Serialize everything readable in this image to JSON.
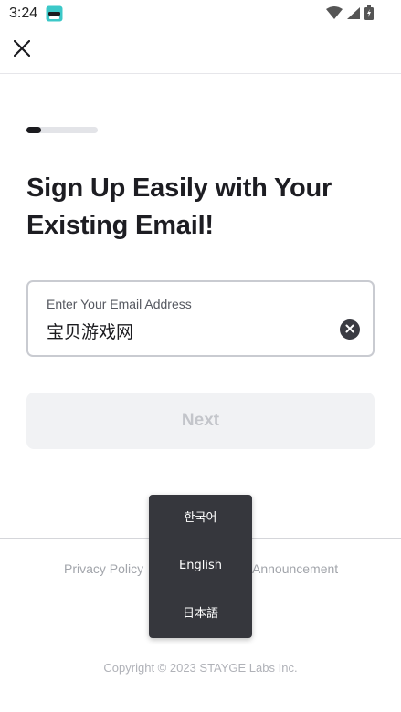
{
  "status_bar": {
    "time": "3:24"
  },
  "signup": {
    "title": "Sign Up Easily with Your Existing Email!",
    "progress": 0.2,
    "email": {
      "label": "Enter Your Email Address",
      "value": "宝贝游戏网"
    },
    "next_label": "Next"
  },
  "footer": {
    "privacy_policy": "Privacy Policy",
    "announcement": "Announcement",
    "copyright": "Copyright © 2023 STAYGE Labs Inc."
  },
  "language_menu": {
    "items": [
      "한국어",
      "English",
      "日本語"
    ]
  },
  "colors": {
    "accent_dark": "#1b1b1f",
    "disabled_bg": "#f1f2f4",
    "disabled_text": "#c3c5ca",
    "menu_bg": "#36373d"
  },
  "icons": {
    "close": "close-icon",
    "clear": "clear-circle-icon",
    "wifi": "wifi-icon",
    "signal": "cellular-signal-icon",
    "battery": "battery-icon",
    "app": "app-notification-icon"
  }
}
